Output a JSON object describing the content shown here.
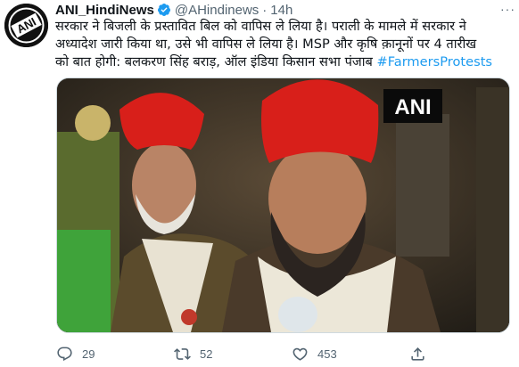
{
  "tweet": {
    "author_name": "ANI_HindiNews",
    "handle": "@AHindinews",
    "separator": "·",
    "time": "14h",
    "more_label": "···",
    "text_lines": [
      "सरकार ने बिजली के प्रस्तावित बिल को वापिस ले लिया है। पराली के मामले में सरकार ने",
      "अध्यादेश जारी किया था, उसे भी वापिस ले लिया है। MSP और कृषि क़ानूनों पर 4 तारीख",
      "को बात होगी: बलकरण सिंह बराड़, ऑल इंडिया किसान सभा पंजाब "
    ],
    "hashtag": "#FarmersProtests",
    "avatar_text": "ANI",
    "media_watermark": "ANI",
    "replies": "29",
    "retweets": "52",
    "likes": "453"
  },
  "colors": {
    "accent": "#1d9bf0",
    "text": "#0f1419",
    "muted": "#536471",
    "turban": "#d81f1a"
  },
  "icons": {
    "verified": "verified-badge-icon",
    "reply": "reply-icon",
    "retweet": "retweet-icon",
    "like": "heart-icon",
    "share": "share-icon"
  }
}
